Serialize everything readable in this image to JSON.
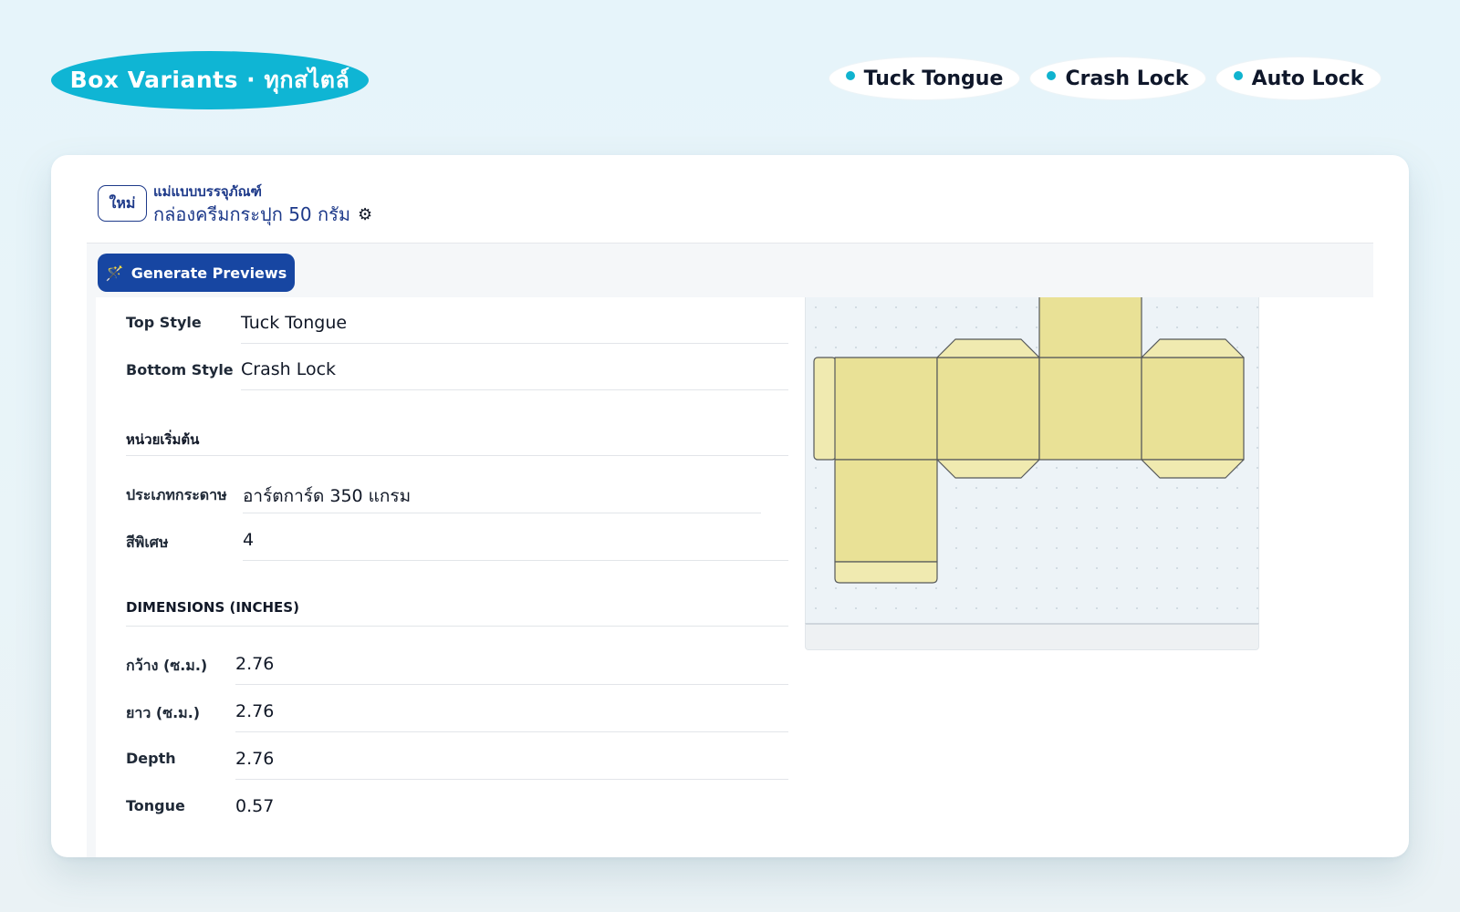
{
  "header": {
    "title": "Box Variants · ทุกสไตล์",
    "chips": [
      "Tuck Tongue",
      "Crash Lock",
      "Auto Lock"
    ]
  },
  "card": {
    "badge": "ใหม่",
    "template_label": "แม่แบบบรรจุภัณฑ์",
    "template_name": "กล่องครีมกระปุก 50 กรัม",
    "generate_label": "Generate Previews"
  },
  "form": {
    "top_style": {
      "label": "Top Style",
      "value": "Tuck Tongue"
    },
    "bottom_style": {
      "label": "Bottom Style",
      "value": "Crash Lock"
    },
    "section_units": "หน่วยเริ่มต้น",
    "paper": {
      "label": "ประเภทกระดาษ",
      "value": "อาร์ตการ์ด 350 แกรม"
    },
    "spot_colors": {
      "label": "สีพิเศษ",
      "value": "4"
    },
    "section_dims": "DIMENSIONS (INCHES)",
    "width": {
      "label": "กว้าง (ซ.ม.)",
      "value": "2.76"
    },
    "length": {
      "label": "ยาว (ซ.ม.)",
      "value": "2.76"
    },
    "depth": {
      "label": "Depth",
      "value": "2.76"
    },
    "tongue": {
      "label": "Tongue",
      "value": "0.57"
    }
  },
  "colors": {
    "accent": "#0fb5d4",
    "primary_button": "#1746a2",
    "panel_fill": "#e9e196",
    "flap_fill": "#f0eab0",
    "panel_stroke": "#55585a"
  }
}
